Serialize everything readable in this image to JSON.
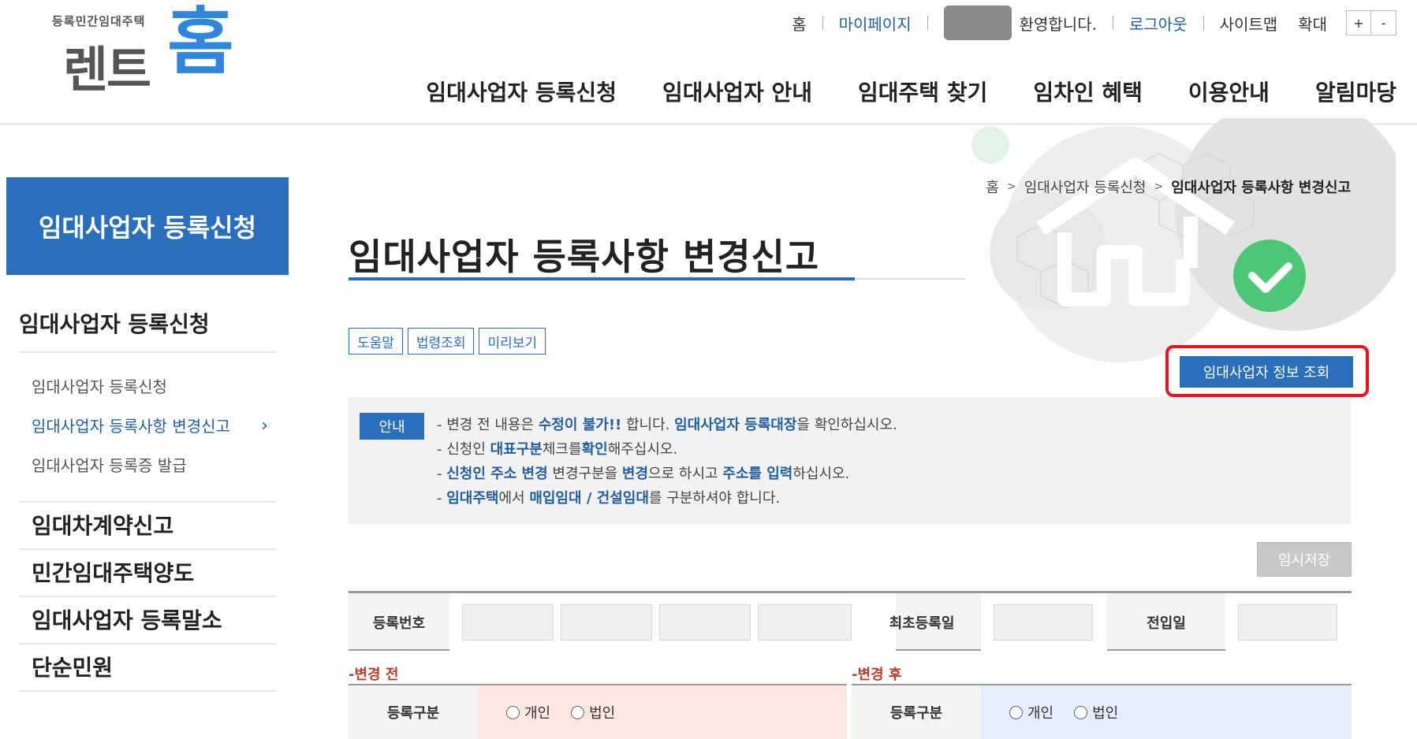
{
  "header": {
    "logo_sub": "등록민간임대주택",
    "logo_main": "렌트",
    "logo_home": "홈",
    "util": {
      "home": "홈",
      "mypage": "마이페이지",
      "welcome": "환영합니다.",
      "logout": "로그아웃",
      "sitemap": "사이트맵",
      "zoom_label": "확대",
      "zoom_in": "+",
      "zoom_out": "-"
    },
    "gnb": [
      "임대사업자 등록신청",
      "임대사업자 안내",
      "임대주택 찾기",
      "임차인 혜택",
      "이용안내",
      "알림마당"
    ]
  },
  "lnb": {
    "title": "임대사업자 등록신청",
    "group1": "임대사업자 등록신청",
    "subs": [
      "임대사업자 등록신청",
      "임대사업자 등록사항 변경신고",
      "임대사업자 등록증 발급"
    ],
    "active_chev": "›",
    "groups": [
      "임대차계약신고",
      "민간임대주택양도",
      "임대사업자 등록말소",
      "단순민원"
    ]
  },
  "breadcrumb": {
    "home": "홈",
    "sep": ">",
    "parent": "임대사업자 등록신청",
    "current": "임대사업자 등록사항 변경신고"
  },
  "page": {
    "title": "임대사업자 등록사항 변경신고",
    "buttons": [
      "도움말",
      "법령조회",
      "미리보기"
    ],
    "info_button": "임대사업자 정보 조회",
    "temp_save": "임시저장"
  },
  "notice": {
    "badge": "안내",
    "l1": [
      "- 변경 전 내용은 ",
      "수정이 불가!!",
      " 합니다. ",
      "임대사업자 등록대장",
      "을 확인하십시오."
    ],
    "l2": [
      "- 신청인 ",
      "대표구분",
      "체크를",
      "확인",
      "해주십시오."
    ],
    "l3": [
      "- ",
      "신청인 주소 변경",
      " 변경구분을 ",
      "변경",
      "으로 하시고 ",
      "주소를 입력",
      "하십시오."
    ],
    "l4": [
      "- ",
      "임대주택",
      "에서 ",
      "매입임대 / 건설임대",
      "를 구분하셔야 합니다."
    ]
  },
  "form": {
    "reg_no": "등록번호",
    "first_reg_date": "최초등록일",
    "move_in_date": "전입일",
    "before_label": "-변경 전",
    "after_label": "-변경 후",
    "reg_type": "등록구분",
    "opt_individual": "개인",
    "opt_corporate": "법인"
  }
}
